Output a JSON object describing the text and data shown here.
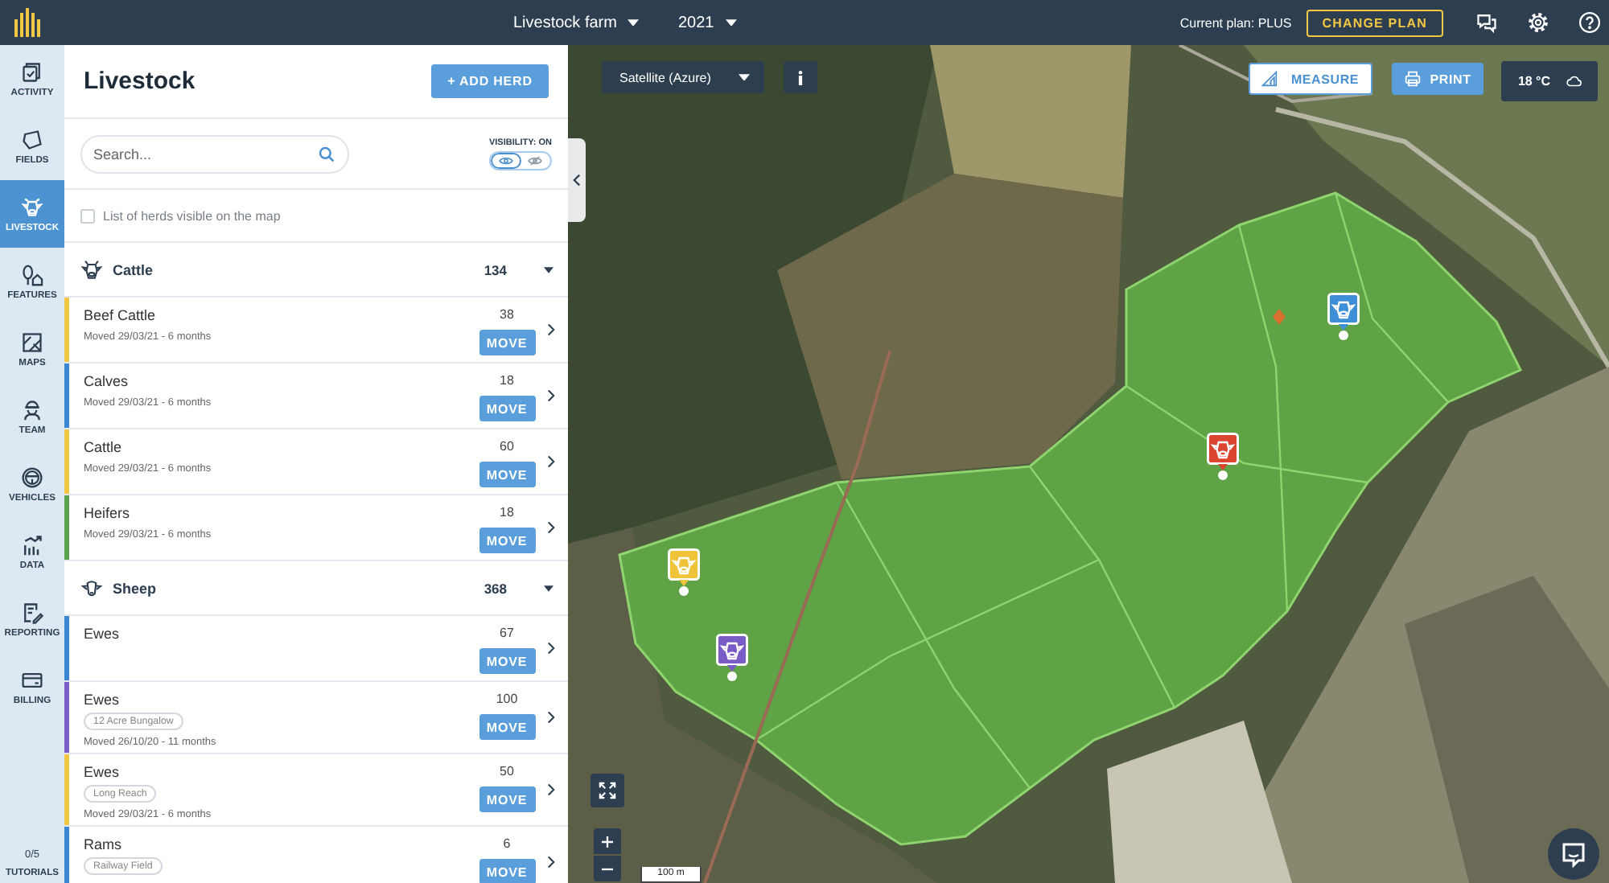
{
  "top_bar": {
    "farm": "Livestock farm",
    "year": "2021",
    "plan": "Current plan: PLUS",
    "change_plan": "CHANGE PLAN"
  },
  "nav": {
    "items": [
      {
        "label": "ACTIVITY",
        "selected": false
      },
      {
        "label": "FIELDS",
        "selected": false
      },
      {
        "label": "LIVESTOCK",
        "selected": true
      },
      {
        "label": "FEATURES",
        "selected": false
      },
      {
        "label": "MAPS",
        "selected": false
      },
      {
        "label": "TEAM",
        "selected": false
      },
      {
        "label": "VEHICLES",
        "selected": false
      },
      {
        "label": "DATA",
        "selected": false
      },
      {
        "label": "REPORTING",
        "selected": false
      },
      {
        "label": "BILLING",
        "selected": false
      }
    ],
    "tutorials": {
      "count": "0/5",
      "label": "TUTORIALS"
    }
  },
  "panel": {
    "title": "Livestock",
    "add_button": "+ ADD HERD",
    "search": {
      "placeholder": "Search..."
    },
    "visibility": {
      "label": "VISIBILITY: ON",
      "on": true
    },
    "map_filter": {
      "label": "List of herds visible on the map",
      "checked": false
    },
    "groups": [
      {
        "kind": "cattle",
        "name": "Cattle",
        "count": "134",
        "expanded": true,
        "herds": [
          {
            "name": "Beef Cattle",
            "moved": "Moved 29/03/21 - 6 months",
            "count": "38",
            "button": "MOVE",
            "color": "#f2c744"
          },
          {
            "name": "Calves",
            "moved": "Moved 29/03/21 - 6 months",
            "count": "18",
            "button": "MOVE",
            "color": "#3b86d1"
          },
          {
            "name": "Cattle",
            "moved": "Moved 29/03/21 - 6 months",
            "count": "60",
            "button": "MOVE",
            "color": "#f2c744"
          },
          {
            "name": "Heifers",
            "moved": "Moved 29/03/21 - 6 months",
            "count": "18",
            "button": "MOVE",
            "color": "#5ba24c"
          }
        ]
      },
      {
        "kind": "sheep",
        "name": "Sheep",
        "count": "368",
        "expanded": true,
        "herds": [
          {
            "name": "Ewes",
            "count": "67",
            "button": "MOVE",
            "color": "#3b86d1"
          },
          {
            "name": "Ewes",
            "field": "12 Acre Bungalow",
            "moved": "Moved 26/10/20 - 11 months",
            "count": "100",
            "button": "MOVE",
            "color": "#7b5ec8"
          },
          {
            "name": "Ewes",
            "field": "Long Reach",
            "moved": "Moved 29/03/21 - 6 months",
            "count": "50",
            "button": "MOVE",
            "color": "#f2c744"
          },
          {
            "name": "Rams",
            "field": "Railway Field",
            "count": "6",
            "button": "MOVE",
            "color": "#3b86d1"
          }
        ]
      }
    ]
  },
  "map": {
    "layer": "Satellite (Azure)",
    "measure": "MEASURE",
    "print": "PRINT",
    "temperature": "18 °C",
    "scale": "100 m",
    "pins": [
      {
        "color": "#3f8fd8"
      },
      {
        "color": "#d9452e"
      },
      {
        "color": "#f0c43a"
      },
      {
        "color": "#7a5cc6"
      }
    ]
  }
}
